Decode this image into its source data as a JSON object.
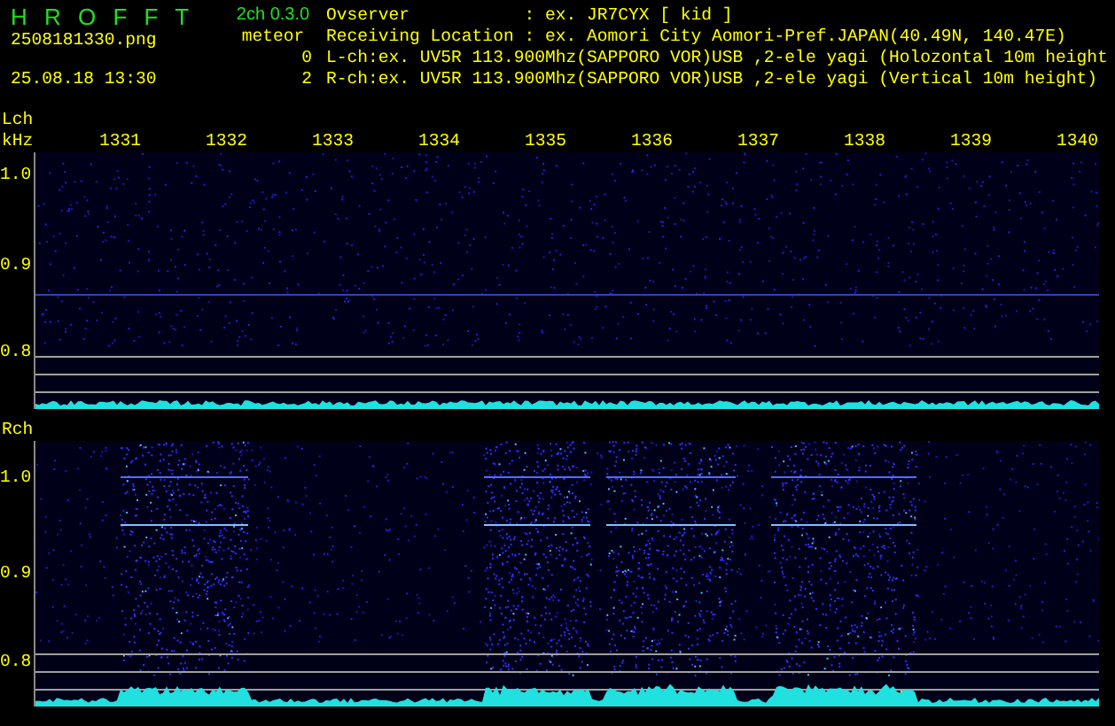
{
  "app": {
    "title": "H R O F F T",
    "version": "2ch 0.3.0"
  },
  "file": {
    "name": "2508181330.png",
    "datetime": "25.08.18 13:30"
  },
  "meteor": {
    "label": "meteor",
    "counts": [
      "0",
      "2"
    ]
  },
  "station_info": [
    "Ovserver           : ex. JR7CYX [ kid ]",
    "Receiving Location : ex. Aomori City Aomori-Pref.JAPAN(40.49N, 140.47E)",
    "L-ch:ex. UV5R 113.900Mhz(SAPPORO VOR)USB ,2-ele yagi (Holozontal 10m height",
    "R-ch:ex. UV5R 113.900Mhz(SAPPORO VOR)USB ,2-ele yagi (Vertical 10m height)"
  ],
  "channels": [
    {
      "name": "Lch",
      "unit": "kHz",
      "kind": "quiet",
      "time_labels": [
        "1331",
        "1332",
        "1333",
        "1334",
        "1335",
        "1336",
        "1337",
        "1338",
        "1339",
        "1340"
      ],
      "y_labels": [
        "1.0",
        "0.9",
        "0.8"
      ]
    },
    {
      "name": "Rch",
      "kind": "bursts",
      "y_labels": [
        "1.0",
        "0.9",
        "0.8"
      ]
    }
  ]
}
